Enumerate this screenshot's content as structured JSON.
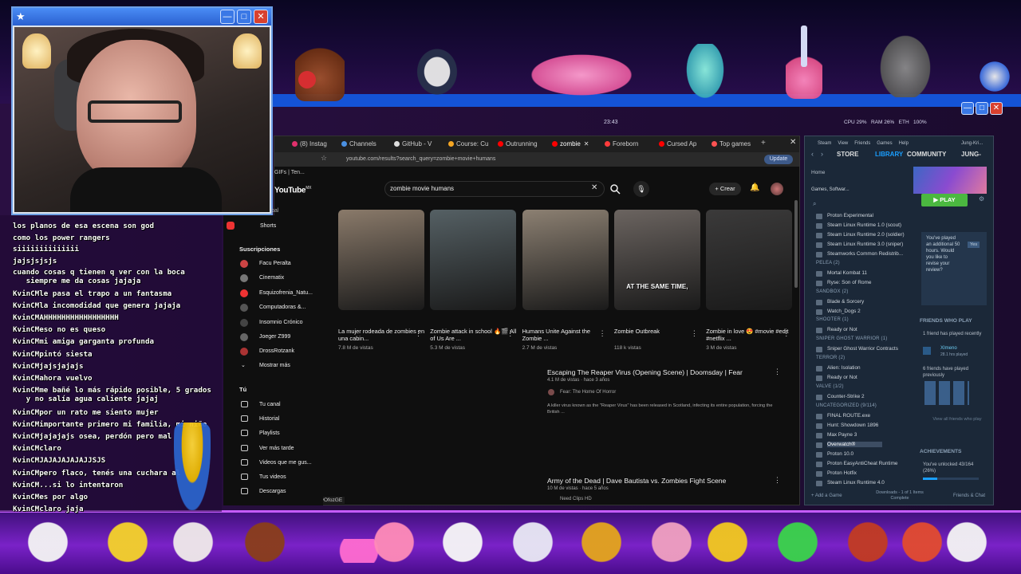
{
  "overlay": {
    "cam_window": {
      "buttons": [
        "—",
        "□",
        "✕"
      ],
      "star": "★"
    },
    "top_clock": "23:43",
    "sys_stats": "CPU 29%   RAM 26%   ETH   100%",
    "status_url": "https://www.youtube.com/shorts/tJSOyOfozGE",
    "top_sprites": [
      "donkey-kong",
      "penguin",
      "pink-muscle-arms",
      "blue-bird",
      "kirby-sword",
      "gray-cat"
    ],
    "bottom_sprites": [
      "white-cat",
      "pacman-face",
      "white-cat-pink",
      "donkey-kong",
      "nyan-cat",
      "kirby",
      "goose",
      "ghost",
      "bowser",
      "chef-kirby",
      "bart-lisa-homer",
      "zombie",
      "fighter",
      "parappa",
      "white-cat"
    ]
  },
  "chat": {
    "lines": [
      {
        "nick": "",
        "text": "los planos de esa escena son god"
      },
      {
        "nick": "",
        "text": "como los power rangers"
      },
      {
        "nick": "",
        "text": "siiiiiiiiiiiiii"
      },
      {
        "nick": "",
        "text": "jajsjsjsjs"
      },
      {
        "nick": "",
        "text": "cuando cosas q tienen q ver con la boca\n   siempre me da cosas jajaja"
      },
      {
        "nick": "KvinCM",
        "text": "le pasa el trapo a un fantasma"
      },
      {
        "nick": "KvinCM",
        "text": "la incomodidad que genera jajaja"
      },
      {
        "nick": "KvinCM",
        "text": "AHHHHHHHHHHHHHHHHH"
      },
      {
        "nick": "KvinCM",
        "text": "eso no es queso"
      },
      {
        "nick": "KvinCM",
        "text": "mi amiga garganta profunda"
      },
      {
        "nick": "KvinCM",
        "text": "pintó siesta"
      },
      {
        "nick": "KvinCM",
        "text": "jajsjajajs"
      },
      {
        "nick": "KvinCM",
        "text": "ahora vuelvo"
      },
      {
        "nick": "KvinCM",
        "text": "me bañé lo más rápido posible, 5 grados\n   y no salía agua caliente jajaj"
      },
      {
        "nick": "KvinCM",
        "text": "por un rato me siento mujer"
      },
      {
        "nick": "KvinCM",
        "text": "importante primero mi familia, mi niño"
      },
      {
        "nick": "KvinCM",
        "text": "jajajajs osea, perdón pero mal"
      },
      {
        "nick": "KvinCM",
        "text": "claro"
      },
      {
        "nick": "KvinCM",
        "text": "JAJAJAJAJAJJSJS"
      },
      {
        "nick": "KvinCM",
        "text": "pero flaco, tenés una cuchara al"
      },
      {
        "nick": "KvinCM",
        "text": "...si lo intentaron"
      },
      {
        "nick": "KvinCM",
        "text": "es por algo"
      },
      {
        "nick": "KvinCM",
        "text": "claro jaja"
      }
    ]
  },
  "browser": {
    "tabs": [
      "(8) Instag",
      "Channels",
      "GitHub - V",
      "Course: Cu",
      "Outrunning",
      "zombie",
      "Foreborn",
      "Cursed Ap",
      "Top games"
    ],
    "active_tab": "zombie",
    "bookmark": "GIFs | Ten...",
    "url": "youtube.com/results?search_query=zombie+movie+humans",
    "update_label": "Update",
    "logo": "YouTube",
    "logo_suffix": "MX",
    "search_value": "zombie movie humans",
    "create_label": "Crear",
    "sidebar": {
      "top_cut": "pal",
      "shorts": "Shorts",
      "subs_title": "Suscripciones",
      "subs": [
        "Facu Peralta",
        "Cinematix",
        "Esquizofrenia_Natu...",
        "Computadoras &...",
        "Insomnio Crónico",
        "Joeger Z999",
        "DrossRotzank"
      ],
      "show_more": "Mostrar más",
      "you_title": "Tú",
      "you_items": [
        "Tu canal",
        "Historial",
        "Playlists",
        "Ver más tarde",
        "Videos que me gus...",
        "Tus videos",
        "Descargas"
      ]
    },
    "shorts": [
      {
        "title": "La mujer rodeada de zombies en una cabin...",
        "views": "7.8 M de vistas",
        "color": "#8a7a6a"
      },
      {
        "title": "Zombie attack in school 🔥🎬 All of Us Are ...",
        "views": "5.3 M de vistas",
        "color": "#556064"
      },
      {
        "title": "Humans Unite Against the Zombie ...",
        "views": "2.7 M de vistas",
        "color": "#8c8072"
      },
      {
        "title": "Zombie Outbreak",
        "views": "118 k vistas",
        "color": "#6b6460",
        "caption": "AT THE SAME TIME,"
      },
      {
        "title": "Zombie in love 😍 #movie #edit #netflix ...",
        "views": "3 M de vistas",
        "color": "#3b3a3a"
      }
    ],
    "results": [
      {
        "title": "Escaping The Reaper Virus (Opening Scene) | Doomsday | Fear",
        "meta": "4.1 M de vistas · hace 3 años",
        "channel": "Fear: The Home Of Horror",
        "desc": "A killer virus known as the \"Reaper Virus\" has been released in Scotland, infecting its entire population, forcing the British ..."
      },
      {
        "title": "Army of the Dead | Dave Bautista vs. Zombies Fight Scene",
        "meta": "10 M de vistas · hace 5 años",
        "channel": "Need Clips HD"
      }
    ]
  },
  "steam": {
    "menu": [
      "Steam",
      "View",
      "Friends",
      "Games",
      "Help"
    ],
    "user": "Jung-Kri...",
    "nav": [
      "STORE",
      "LIBRARY",
      "COMMUNITY",
      "JUNG-"
    ],
    "active_nav": "LIBRARY",
    "home": "Home",
    "filter": "Games, Softwar...",
    "play": "PLAY",
    "review_text": "You've played an additional 50 hours. Would you like to revise your review?",
    "review_yes": "Yes",
    "friends_title": "FRIENDS WHO PLAY",
    "friends_recent": "1 friend has played recently",
    "friend_name": "XImeno",
    "friend_hours": "28.1 hrs played",
    "friends_prev": "6 friends have played previously",
    "view_all": "View all friends who play",
    "achievements_title": "ACHIEVEMENTS",
    "achievements_text": "You've unlocked 43/164 (26%)",
    "add_game": "Add a Game",
    "downloads": "Downloads - 1 of 1 Items Complete",
    "friends_chat": "Friends & Chat",
    "library": [
      {
        "type": "game",
        "name": "Proton Experimental"
      },
      {
        "type": "game",
        "name": "Steam Linux Runtime 1.0 (scout)"
      },
      {
        "type": "game",
        "name": "Steam Linux Runtime 2.0 (soldier)"
      },
      {
        "type": "game",
        "name": "Steam Linux Runtime 3.0 (sniper)"
      },
      {
        "type": "game",
        "name": "Steamworks Common Redistrib..."
      },
      {
        "type": "cat",
        "name": "PELEA (2)"
      },
      {
        "type": "game",
        "name": "Mortal Kombat 11"
      },
      {
        "type": "game",
        "name": "Ryse: Son of Rome"
      },
      {
        "type": "cat",
        "name": "SANDBOX (2)"
      },
      {
        "type": "game",
        "name": "Blade & Sorcery"
      },
      {
        "type": "game",
        "name": "Watch_Dogs 2"
      },
      {
        "type": "cat",
        "name": "SHOOTER (1)"
      },
      {
        "type": "game",
        "name": "Ready or Not"
      },
      {
        "type": "cat",
        "name": "SNIPER GHOST WARRIOR (1)"
      },
      {
        "type": "game",
        "name": "Sniper Ghost Warrior Contracts"
      },
      {
        "type": "cat",
        "name": "TERROR (2)"
      },
      {
        "type": "game",
        "name": "Alien: Isolation"
      },
      {
        "type": "game",
        "name": "Ready or Not"
      },
      {
        "type": "cat",
        "name": "VALVE (1/2)"
      },
      {
        "type": "game",
        "name": "Counter-Strike 2"
      },
      {
        "type": "cat",
        "name": "UNCATEGORIZED (9/114)"
      },
      {
        "type": "game",
        "name": "FINAL ROUTE.exe"
      },
      {
        "type": "game",
        "name": "Hunt: Showdown 1896"
      },
      {
        "type": "game",
        "name": "Max Payne 3"
      },
      {
        "type": "game",
        "name": "Overwatch®",
        "selected": true
      },
      {
        "type": "game",
        "name": "Proton 10.0"
      },
      {
        "type": "game",
        "name": "Proton EasyAntiCheat Runtime"
      },
      {
        "type": "game",
        "name": "Proton Hotfix"
      },
      {
        "type": "game",
        "name": "Steam Linux Runtime 4.0"
      }
    ]
  }
}
